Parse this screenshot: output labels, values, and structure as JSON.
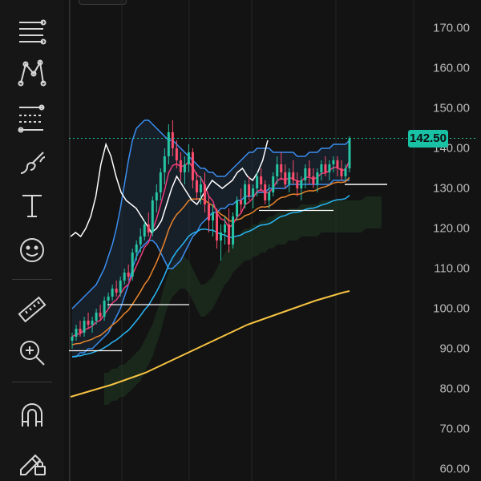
{
  "toolbar": {
    "tools": [
      {
        "name": "trend-lines-icon"
      },
      {
        "name": "patterns-icon"
      },
      {
        "name": "fib-tools-icon"
      },
      {
        "name": "brush-icon"
      },
      {
        "name": "text-tool-icon"
      },
      {
        "name": "emoji-icon"
      },
      {
        "name": "ruler-icon"
      },
      {
        "name": "zoom-in-icon"
      },
      {
        "name": "magnet-icon"
      },
      {
        "name": "lock-drawings-icon"
      }
    ]
  },
  "price_axis": {
    "ticks": [
      "170.00",
      "160.00",
      "150.00",
      "140.00",
      "130.00",
      "120.00",
      "110.00",
      "100.00",
      "90.00",
      "80.00",
      "70.00",
      "60.00"
    ],
    "last_price": "142.50",
    "last_price_color": "#19c2a4"
  },
  "chart_data": {
    "type": "candlestick",
    "ylim": [
      57,
      177
    ],
    "x_count": 90,
    "colors": {
      "up": "#26c6a4",
      "down": "#ff4d6d",
      "bb": "#3b8ef0",
      "ema_long": "#f5c242",
      "ema_mid": "#e8842c",
      "ema_short": "#ec3d7a",
      "sma": "#29b6f6",
      "comparison": "#ffffff"
    },
    "series": [
      {
        "name": "",
        "kind": "ohlc",
        "values": [
          [
            92,
            94,
            90,
            93
          ],
          [
            93,
            96,
            92,
            95
          ],
          [
            95,
            97,
            93,
            94
          ],
          [
            94,
            98,
            93,
            97
          ],
          [
            97,
            99,
            95,
            96
          ],
          [
            96,
            98,
            94,
            97
          ],
          [
            97,
            100,
            96,
            99
          ],
          [
            99,
            101,
            97,
            98
          ],
          [
            98,
            103,
            97,
            102
          ],
          [
            102,
            104,
            100,
            103
          ],
          [
            103,
            106,
            102,
            105
          ],
          [
            105,
            107,
            103,
            104
          ],
          [
            104,
            108,
            103,
            107
          ],
          [
            107,
            110,
            106,
            109
          ],
          [
            109,
            111,
            107,
            108
          ],
          [
            108,
            115,
            107,
            114
          ],
          [
            114,
            117,
            112,
            116
          ],
          [
            116,
            120,
            114,
            118
          ],
          [
            118,
            122,
            117,
            121
          ],
          [
            121,
            124,
            118,
            119
          ],
          [
            119,
            128,
            118,
            127
          ],
          [
            127,
            131,
            124,
            129
          ],
          [
            129,
            135,
            127,
            134
          ],
          [
            134,
            140,
            131,
            138
          ],
          [
            138,
            146,
            136,
            144
          ],
          [
            144,
            147,
            138,
            140
          ],
          [
            140,
            142,
            135,
            137
          ],
          [
            137,
            139,
            132,
            134
          ],
          [
            134,
            138,
            131,
            136
          ],
          [
            136,
            141,
            134,
            139
          ],
          [
            139,
            140,
            130,
            132
          ],
          [
            132,
            134,
            127,
            129
          ],
          [
            129,
            133,
            126,
            131
          ],
          [
            131,
            134,
            124,
            126
          ],
          [
            126,
            128,
            119,
            122
          ],
          [
            122,
            126,
            118,
            124
          ],
          [
            124,
            125,
            115,
            117
          ],
          [
            117,
            121,
            112,
            119
          ],
          [
            119,
            123,
            116,
            121
          ],
          [
            121,
            125,
            114,
            116
          ],
          [
            116,
            124,
            115,
            123
          ],
          [
            123,
            128,
            122,
            127
          ],
          [
            127,
            130,
            124,
            126
          ],
          [
            126,
            132,
            125,
            131
          ],
          [
            131,
            133,
            127,
            128
          ],
          [
            128,
            131,
            125,
            130
          ],
          [
            130,
            134,
            128,
            133
          ],
          [
            133,
            135,
            129,
            131
          ],
          [
            131,
            132,
            126,
            127
          ],
          [
            127,
            131,
            125,
            129
          ],
          [
            129,
            134,
            128,
            133
          ],
          [
            133,
            138,
            131,
            136
          ],
          [
            136,
            139,
            132,
            134
          ],
          [
            134,
            136,
            130,
            131
          ],
          [
            131,
            135,
            129,
            134
          ],
          [
            134,
            137,
            131,
            132
          ],
          [
            132,
            134,
            128,
            130
          ],
          [
            130,
            133,
            127,
            132
          ],
          [
            132,
            136,
            130,
            135
          ],
          [
            135,
            137,
            131,
            133
          ],
          [
            133,
            135,
            130,
            131
          ],
          [
            131,
            135,
            129,
            134
          ],
          [
            134,
            137,
            132,
            136
          ],
          [
            136,
            138,
            133,
            134
          ],
          [
            134,
            137,
            132,
            136
          ],
          [
            136,
            138,
            134,
            137
          ],
          [
            137,
            138,
            133,
            135
          ],
          [
            135,
            137,
            132,
            133
          ],
          [
            133,
            136,
            132,
            135
          ],
          [
            135,
            143,
            134,
            142.5
          ]
        ]
      },
      {
        "name": "",
        "kind": "bb_upper",
        "values": [
          100,
          101,
          102,
          103,
          104,
          105,
          106,
          108,
          110,
          113,
          116,
          120,
          125,
          131,
          137,
          142,
          145,
          146,
          147,
          147,
          146,
          145,
          144,
          143,
          142,
          142,
          141,
          140,
          139,
          138,
          137,
          136,
          135,
          135,
          134,
          134,
          133,
          133,
          133,
          134,
          135,
          136,
          137,
          138,
          139,
          139,
          140,
          140,
          140,
          140,
          139,
          139,
          139,
          139,
          139,
          139,
          138,
          138,
          138,
          139,
          139,
          139,
          140,
          140,
          140,
          141,
          141,
          141,
          141,
          142
        ]
      },
      {
        "name": "",
        "kind": "bb_lower",
        "values": [
          88,
          88,
          89,
          89,
          90,
          90,
          91,
          92,
          93,
          94,
          96,
          98,
          100,
          103,
          106,
          110,
          113,
          115,
          116,
          117,
          117,
          116,
          114,
          112,
          110,
          110,
          111,
          112,
          114,
          116,
          118,
          119,
          121,
          122,
          123,
          124,
          124,
          125,
          125,
          126,
          126,
          127,
          127,
          128,
          128,
          128,
          129,
          129,
          129,
          130,
          130,
          130,
          130,
          130,
          131,
          131,
          131,
          131,
          131,
          131,
          131,
          131,
          131,
          131,
          131,
          132,
          132,
          132,
          132,
          132
        ]
      },
      {
        "name": "",
        "kind": "ema_long",
        "values": [
          78,
          78.5,
          79,
          79.5,
          80,
          80.5,
          81,
          81.6,
          82.2,
          82.8,
          83.4,
          84,
          84.8,
          85.6,
          86.4,
          87.2,
          88,
          88.8,
          89.6,
          90.4,
          91.2,
          92,
          92.8,
          93.6,
          94.4,
          95.2,
          96,
          96.6,
          97.2,
          97.8,
          98.4,
          99,
          99.6,
          100.2,
          100.8,
          101.4,
          102,
          102.5,
          103,
          103.5,
          104,
          104.4
        ]
      },
      {
        "name": "",
        "kind": "comparison",
        "values": [
          118,
          119,
          118,
          120,
          123,
          128,
          136,
          141,
          138,
          133,
          129,
          127,
          126,
          125,
          123,
          121,
          119,
          120,
          122,
          126,
          130,
          133,
          131,
          129,
          127,
          126,
          128,
          130,
          132,
          131,
          130,
          131,
          132,
          134,
          135,
          133,
          132,
          134,
          137,
          142
        ]
      }
    ]
  }
}
